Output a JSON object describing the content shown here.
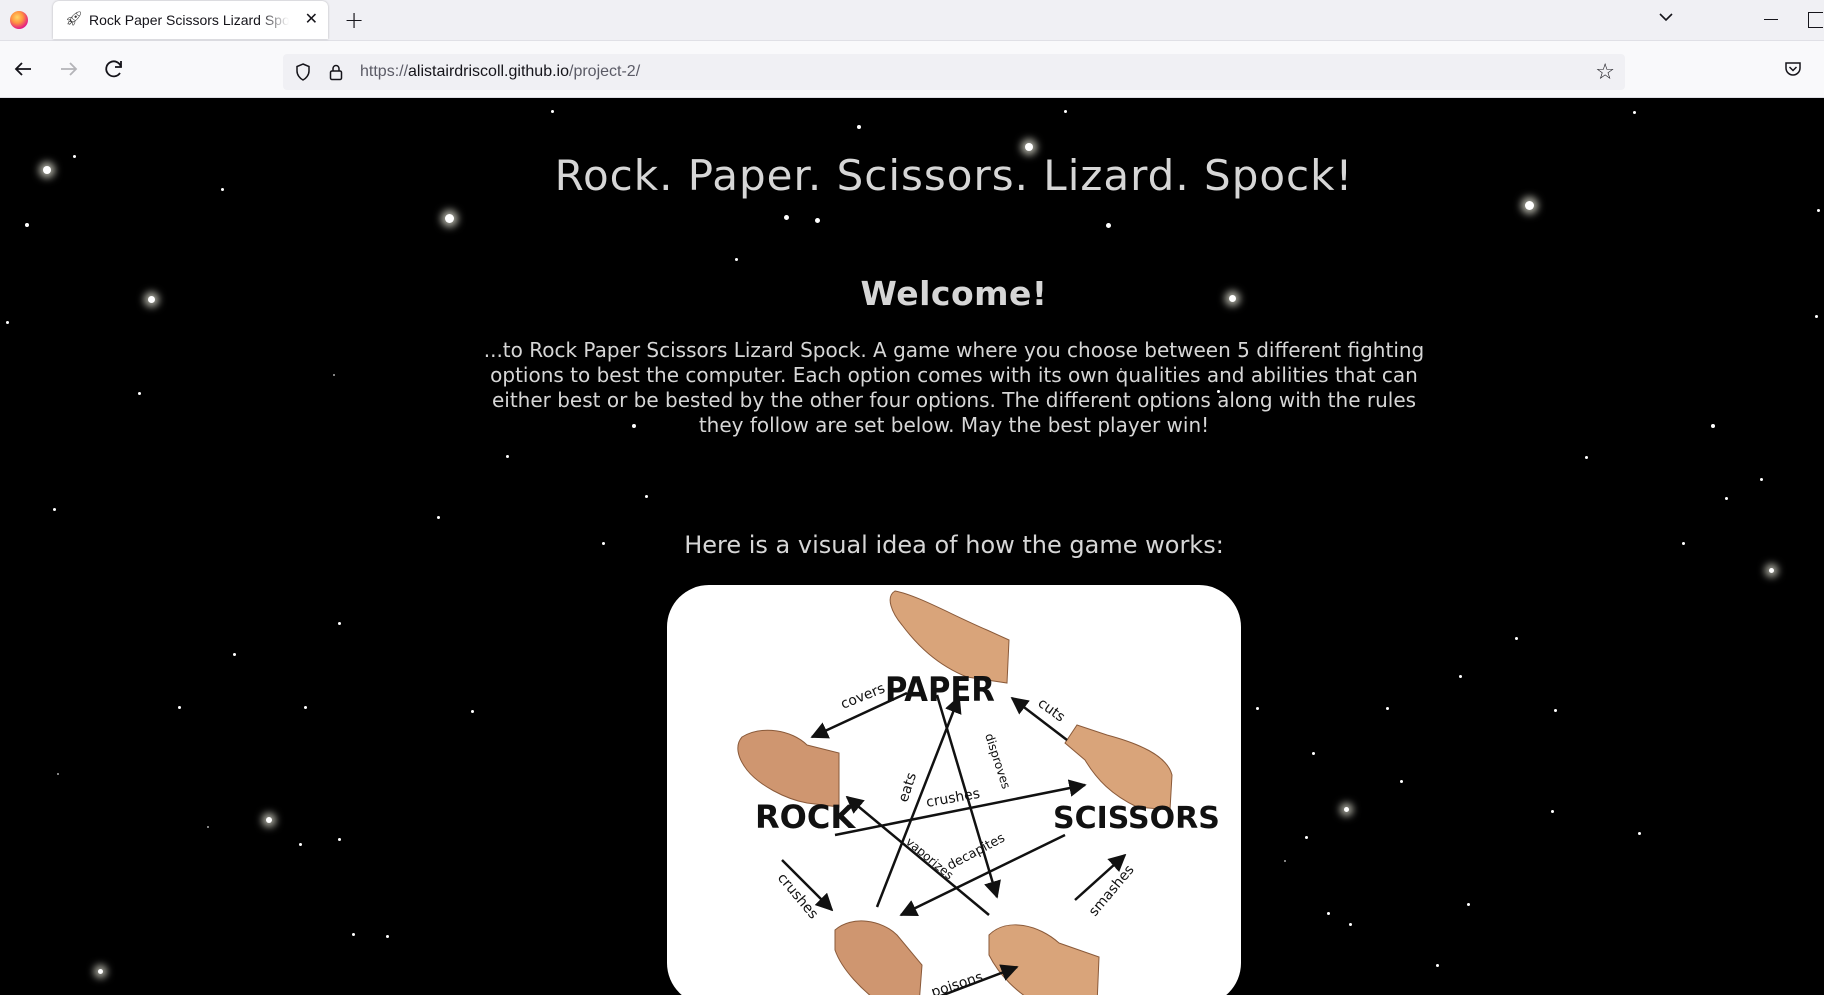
{
  "browser": {
    "tab_title": "Rock Paper Scissors Lizard Spock",
    "url_scheme": "https://",
    "url_host": "alistairdriscoll.github.io",
    "url_path": "/project-2/",
    "icons": {
      "firefox": "firefox-logo",
      "tab_favicon": "rocket-icon",
      "close": "close-icon",
      "new_tab": "plus-icon",
      "tab_list": "chevron-down-icon",
      "back": "arrow-left-icon",
      "forward": "arrow-right-icon",
      "reload": "reload-icon",
      "shield": "shield-icon",
      "lock": "lock-icon",
      "bookmark": "star-icon",
      "pocket": "pocket-icon"
    }
  },
  "page": {
    "title": "Rock. Paper. Scissors. Lizard. Spock!",
    "welcome_heading": "Welcome!",
    "intro_text": "...to Rock Paper Scissors Lizard Spock. A game where you choose between 5 different fighting options to best the computer. Each option comes with its own qualities and abilities that can either best or be bested by the other four options. The different options along with the rules they follow are set below. May the best player win!",
    "visual_heading": "Here is a visual idea of how the game works:",
    "diagram": {
      "nodes": [
        "PAPER",
        "ROCK",
        "SCISSORS"
      ],
      "verbs": [
        "covers",
        "cuts",
        "eats",
        "disproves",
        "crushes",
        "vaporizes",
        "decapites",
        "crushes",
        "smashes",
        "poisons"
      ]
    },
    "colors": {
      "background": "#000000",
      "text": "#d6d6d6",
      "card": "#ffffff"
    }
  }
}
